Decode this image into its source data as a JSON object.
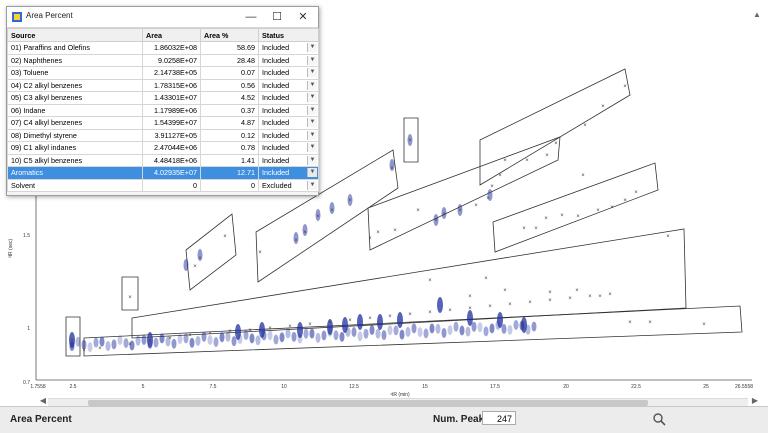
{
  "window": {
    "title": "Area Percent",
    "controls": {
      "minimize": "—",
      "maximize": "☐",
      "close": "✕"
    }
  },
  "table": {
    "columns": [
      "Source",
      "Area",
      "Area %",
      "Status"
    ],
    "rows": [
      {
        "source": "01) Paraffins and Olefins",
        "area": "1.86032E+08",
        "pct": "58.69",
        "status": "Included"
      },
      {
        "source": "02) Naphthenes",
        "area": "9.0258E+07",
        "pct": "28.48",
        "status": "Included"
      },
      {
        "source": "03) Toluene",
        "area": "2.14738E+05",
        "pct": "0.07",
        "status": "Included"
      },
      {
        "source": "04) C2 alkyl benzenes",
        "area": "1.78315E+06",
        "pct": "0.56",
        "status": "Included"
      },
      {
        "source": "05) C3 alkyl benzenes",
        "area": "1.43301E+07",
        "pct": "4.52",
        "status": "Included"
      },
      {
        "source": "06) Indane",
        "area": "1.17989E+06",
        "pct": "0.37",
        "status": "Included"
      },
      {
        "source": "07) C4 alkyl benzenes",
        "area": "1.54399E+07",
        "pct": "4.87",
        "status": "Included"
      },
      {
        "source": "08) Dimethyl styrene",
        "area": "3.91127E+05",
        "pct": "0.12",
        "status": "Included"
      },
      {
        "source": "09) C1 alkyl indanes",
        "area": "2.47044E+06",
        "pct": "0.78",
        "status": "Included"
      },
      {
        "source": "10) C5 alkyl benzenes",
        "area": "4.48418E+06",
        "pct": "1.41",
        "status": "Included"
      },
      {
        "source": "Aromatics",
        "area": "4.02935E+07",
        "pct": "12.71",
        "status": "Included"
      },
      {
        "source": "Solvent",
        "area": "0",
        "pct": "0",
        "status": "Excluded"
      }
    ],
    "selected_index": 10
  },
  "plot": {
    "y_label": "²tR (sec)",
    "x_label": "¹tR (min)",
    "x_ticks": [
      "1.7558",
      "2.5",
      "5",
      "7.5",
      "10",
      "12.5",
      "15",
      "17.5",
      "20",
      "22.5",
      "25",
      "26.5558"
    ],
    "y_ticks": [
      "1.5",
      "1",
      "0.7"
    ]
  },
  "status_bar": {
    "title": "Area Percent",
    "num_peaks_label": "Num. Peaks",
    "num_peaks_value": "247"
  },
  "icons": {
    "app": "app-icon",
    "search": "search-icon"
  },
  "colors": {
    "selected_row": "#3f8fe0",
    "peak_blue": "#1f2f9e",
    "peak_marker": "#444444",
    "region_outline": "#333333"
  }
}
